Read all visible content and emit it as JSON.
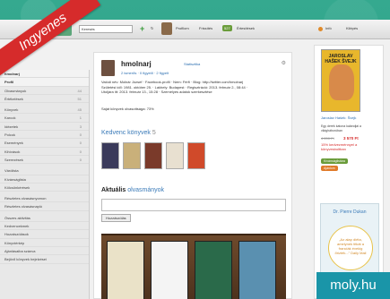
{
  "ribbon": "Ingyenes",
  "watermark": "moly.hu",
  "topbar": {
    "search_value": "Keresés",
    "profile_label": "Profilom",
    "friends_label": "Frissítés",
    "badge": "527",
    "ertesitesek": "Értesítések",
    "info_label": "Infó",
    "kilepes_label": "Kilépés"
  },
  "sidebar": {
    "items": [
      {
        "label": "hmolnarj",
        "count": ""
      },
      {
        "label": "Profil",
        "count": ""
      },
      {
        "label": "Olvasmányok",
        "count": "44"
      },
      {
        "label": "Értékelések",
        "count": "51"
      },
      {
        "label": "Könyvek",
        "count": "45"
      },
      {
        "label": "Karcok",
        "count": "1"
      },
      {
        "label": "Idézetek",
        "count": "3"
      },
      {
        "label": "Polcok",
        "count": "0"
      },
      {
        "label": "Események",
        "count": "0"
      },
      {
        "label": "Kihívások",
        "count": "0"
      },
      {
        "label": "Szerezések",
        "count": "0"
      },
      {
        "label": "Várólista",
        "count": ""
      },
      {
        "label": "Kívánságlista",
        "count": ""
      },
      {
        "label": "Kölcsönkérések",
        "count": ""
      },
      {
        "label": "Részletes olvasásnyomon",
        "count": ""
      },
      {
        "label": "Részletes olvasásnapló",
        "count": ""
      },
      {
        "label": "Összes aktivitás",
        "count": ""
      },
      {
        "label": "Kedvencekmek",
        "count": ""
      },
      {
        "label": "Hozzászólások",
        "count": ""
      },
      {
        "label": "Könyvtérkép",
        "count": ""
      },
      {
        "label": "Ajánlásaiba szánva",
        "count": ""
      },
      {
        "label": "Bejövő könyvek bejelzései",
        "count": ""
      }
    ]
  },
  "profile": {
    "username": "hmolnarj",
    "stat_link": "Statisztika",
    "follow": "2 ismerős · 0 figyelő · 2 figyelt",
    "info_line1": "Valódi név: Molnár József · Facebook-profil · Nem: Férfi · Blog: http://twitter.com/hmolnarj",
    "info_line2": "Születési idő: 1981. október 25. · Lakhely: Budapest · Regisztráció: 2013. február 2., 08:44 ·",
    "info_line3": "Utoljára itt: 2013. február 13., 15:28 · Személyes adatok szerkesztése",
    "progress": "Saját könyvek olvasottsága: 73%"
  },
  "kedvenc": {
    "title": "Kedvenc könyvek",
    "count": "5"
  },
  "aktualis": {
    "title": "Aktuális",
    "suffix": "olvasmányok",
    "button": "Hozzászólás"
  },
  "right": {
    "cover_title": "JAROSLAV HAŠEK ŠVEJK",
    "title": "Jaroslav Hašek: Švejk",
    "desc": "Egy derék katona kalandjai a világháborúban",
    "old_price": "4 200 Ft",
    "new_price": "3 570 Ft",
    "discount": "15% kedvezménnyel a könyvesboltban",
    "green_badge": "Kívánságlistára",
    "orange_badge": "Ajánlom",
    "ad_author": "Dr. Pierre Dukan",
    "ad_quote": "„Az alap diéta, amelynek titkát a franciák évekig őrizték...” Daily Mail"
  }
}
